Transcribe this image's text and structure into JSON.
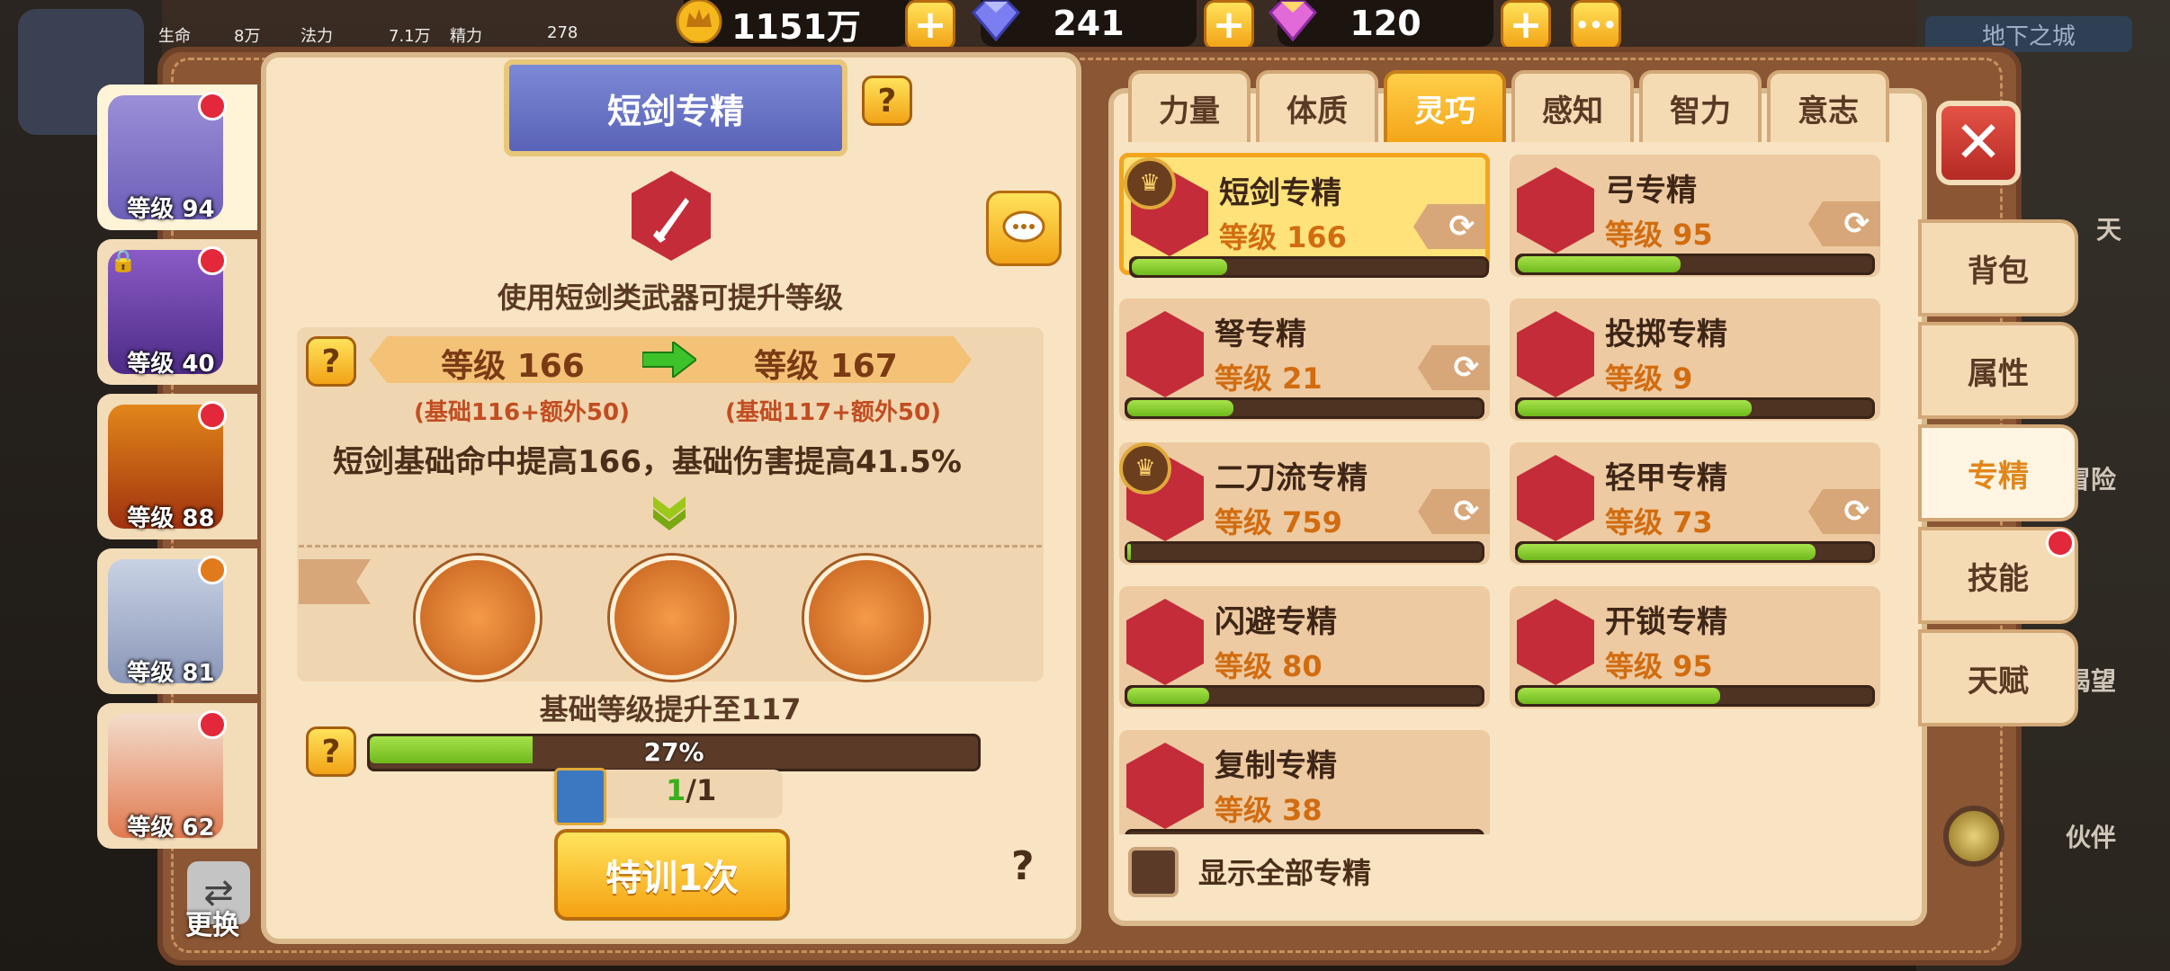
{
  "top_bar": {
    "gold": "1151万",
    "diamond_blue": "241",
    "diamond_rainbow": "120",
    "hp_label": "生命",
    "hp_value": "8万",
    "mp_label": "法力",
    "mp_value": "7.1万",
    "sp_label": "精力",
    "sp_value": "278",
    "more": "•••",
    "location": "地下之城"
  },
  "characters": [
    {
      "level": "等级 94",
      "active": true
    },
    {
      "level": "等级 40"
    },
    {
      "level": "等级 88"
    },
    {
      "level": "等级 81"
    },
    {
      "level": "等级 62"
    }
  ],
  "left_panel": {
    "title": "短剑专精",
    "description": "使用短剑类武器可提升等级",
    "level_from": "等级 166",
    "level_to": "等级 167",
    "from_detail": "(基础116+额外50)",
    "to_detail": "(基础117+额外50)",
    "effect": "短剑基础命中提高166，基础伤害提高41.5%",
    "base_upgrade": "基础等级提升至117",
    "progress_text": "27%",
    "progress_value": 0.27,
    "book_count_have": "1",
    "book_count_total": "/1",
    "train_button": "特训1次",
    "help": "?",
    "swap_label": "更换"
  },
  "tabs": [
    "力量",
    "体质",
    "灵巧",
    "感知",
    "智力",
    "意志"
  ],
  "active_tab": 2,
  "specialties": [
    {
      "name": "短剑专精",
      "level": "等级 166",
      "progress": 0.27,
      "selected": true,
      "medal": true,
      "swap": true
    },
    {
      "name": "弓专精",
      "level": "等级 95",
      "progress": 0.46,
      "swap": true
    },
    {
      "name": "弩专精",
      "level": "等级 21",
      "progress": 0.3,
      "swap": true
    },
    {
      "name": "投掷专精",
      "level": "等级 9",
      "progress": 0.66
    },
    {
      "name": "二刀流专精",
      "level": "等级 759",
      "progress": 0.01,
      "medal": true,
      "swap": true
    },
    {
      "name": "轻甲专精",
      "level": "等级 73",
      "progress": 0.84,
      "swap": true
    },
    {
      "name": "闪避专精",
      "level": "等级 80",
      "progress": 0.23
    },
    {
      "name": "开锁专精",
      "level": "等级 95",
      "progress": 0.57
    },
    {
      "name": "复制专精",
      "level": "等级 38",
      "progress": 0.0
    }
  ],
  "show_all_label": "显示全部专精",
  "side_menu": [
    "背包",
    "属性",
    "专精",
    "技能",
    "天赋"
  ],
  "side_active": 2,
  "far_right": [
    "天",
    "冒险",
    "渴望",
    "伙伴"
  ],
  "colors": {
    "accent": "#f5a518",
    "frame": "#8a5634",
    "panel": "#f8e4c2",
    "red": "#c42c3a",
    "green": "#6eb91c"
  }
}
